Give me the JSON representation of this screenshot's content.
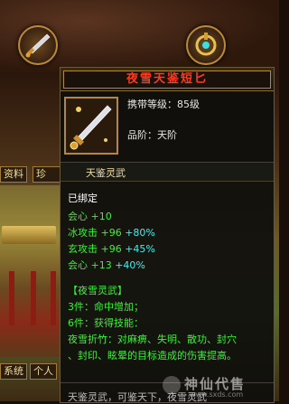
{
  "side_tabs": {
    "info": "资料",
    "treasure": "珍",
    "system": "系统",
    "personal": "个人"
  },
  "tooltip": {
    "title": "夜雪天鉴短匕",
    "carry_level": "携带等级：85级",
    "grade": "品阶：天阶",
    "subtitle": "天鉴灵武",
    "bound": "已绑定",
    "base_stats": [
      {
        "name": "会心",
        "value": "+10",
        "extra": ""
      },
      {
        "name": "冰攻击",
        "value": "+96",
        "extra": "+80%"
      },
      {
        "name": "玄攻击",
        "value": "+96",
        "extra": "+45%"
      },
      {
        "name": "会心",
        "value": "+13",
        "extra": "+40%"
      }
    ],
    "set_name": "【夜雪灵武】",
    "set_3": "3件：命中增加；",
    "set_6": "6件：获得技能：",
    "skill_line1": "夜雪折竹：对麻痹、失明、散功、封穴",
    "skill_line2": "、封印、眩晕的目标造成的伤害提高。",
    "bottom_partial": "天鉴灵武，可鉴天下，夜雪灵武"
  },
  "watermark": {
    "text": "神仙代售",
    "url": "www.sxds.com"
  },
  "colors": {
    "title": "#ff3a20",
    "green": "#3ef03a",
    "cyan": "#40f0f0",
    "gold": "#f0dca0"
  }
}
